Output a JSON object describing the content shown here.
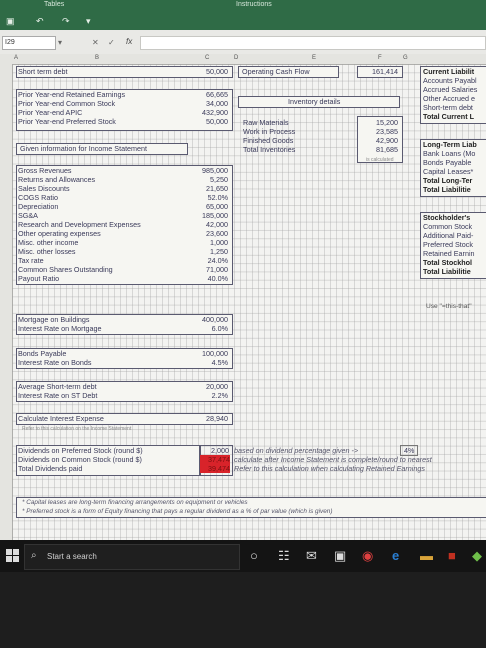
{
  "app": {
    "title": "Tables",
    "title2": "Instructions",
    "name_box": "I29"
  },
  "toolbar": {
    "save": "save-icon",
    "undo": "↶",
    "redo": "↷",
    "fx": "fx",
    "cancel": "✕",
    "confirm": "✓"
  },
  "columns": [
    "A",
    "B",
    "C",
    "D",
    "E",
    "F",
    "G"
  ],
  "left": {
    "short_term_debt": {
      "label": "Short term debt",
      "value": "50,000"
    },
    "prior": [
      {
        "label": "Prior Year-end Retained Earnings",
        "value": "66,665"
      },
      {
        "label": "Prior Year-end Common Stock",
        "value": "34,000"
      },
      {
        "label": "Prior Year-end APIC",
        "value": "432,900"
      },
      {
        "label": "Prior Year-end Preferred Stock",
        "value": "50,000"
      }
    ],
    "given_header": "Given information for Income Statement",
    "income": [
      {
        "label": "Gross Revenues",
        "value": "985,000"
      },
      {
        "label": "Returns and Allowances",
        "value": "5,250"
      },
      {
        "label": "Sales Discounts",
        "value": "21,650"
      },
      {
        "label": "COGS Ratio",
        "value": "52.0%"
      },
      {
        "label": "Depreciation",
        "value": "65,000"
      },
      {
        "label": "SG&A",
        "value": "185,000"
      },
      {
        "label": "Research and Development Expenses",
        "value": "42,000"
      },
      {
        "label": "Other operating expenses",
        "value": "23,600"
      },
      {
        "label": "Misc. other income",
        "value": "1,000"
      },
      {
        "label": "Misc. other losses",
        "value": "1,250"
      },
      {
        "label": "Tax rate",
        "value": "24.0%"
      },
      {
        "label": "Common Shares Outstanding",
        "value": "71,000"
      },
      {
        "label": "Payout Ratio",
        "value": "40.0%"
      }
    ],
    "mortgage": [
      {
        "label": "Mortgage on Buildings",
        "value": "400,000"
      },
      {
        "label": "Interest Rate on Mortgage",
        "value": "6.0%"
      }
    ],
    "bonds": [
      {
        "label": "Bonds Payable",
        "value": "100,000"
      },
      {
        "label": "Interest Rate on Bonds",
        "value": "4.5%"
      }
    ],
    "st_debt": [
      {
        "label": "Average Short-term debt",
        "value": "20,000"
      },
      {
        "label": "Interest Rate on ST Debt",
        "value": "2.2%"
      }
    ],
    "interest": {
      "label": "Calculate Interest Expense",
      "value": "28,940",
      "note": "Refer to this calculation on the Income Statement"
    },
    "dividends": [
      {
        "label": "Dividends on Preferred Stock  (round $)",
        "value": "2,000",
        "note": "based on dividend percentage given ->",
        "extra": "4%"
      },
      {
        "label": "Dividends on Common Stock  (round $)",
        "value": "37,474",
        "note": "calculate after Income Statement is complete/round to nearest"
      },
      {
        "label": "Total Dividends paid",
        "value": "39,474",
        "note": "Refer to this calculation when calculating Retained Earnings"
      }
    ],
    "footnotes": [
      "* Capital leases are long-term financing arrangements on equipment or vehicles",
      "* Preferred stock is a form of Equity financing that pays a regular dividend as a % of par value (which is given)"
    ]
  },
  "middle": {
    "ocf": "Operating Cash Flow",
    "ocf_value": "161,414",
    "inventory_header": "Inventory details",
    "inventory": [
      {
        "label": "Raw Materials",
        "value": "15,200"
      },
      {
        "label": "Work in Process",
        "value": "23,585"
      },
      {
        "label": "Finished Goods",
        "value": "42,900"
      },
      {
        "label": "Total Inventories",
        "value": "81,685"
      }
    ],
    "calc_note": "is calculated"
  },
  "right": {
    "current": [
      "Current Liabilit",
      "Accounts Payabl",
      "Accrued Salaries",
      "Other Accrued e",
      "Short-term debt",
      "Total Current L"
    ],
    "longterm": [
      "Long-Term Liab",
      "Bank Loans (Mo",
      "Bonds Payable",
      "Capital Leases*",
      "Total Long-Ter",
      "Total Liabilitie"
    ],
    "equity": [
      "Stockholder's",
      "Common Stock",
      "Additional Paid-",
      "Preferred Stock",
      "Retained Earnin",
      "Total Stockhol",
      "Total Liabilitie"
    ],
    "use_note": "Use \"=this-that\""
  },
  "taskbar": {
    "search": "Start a search"
  }
}
